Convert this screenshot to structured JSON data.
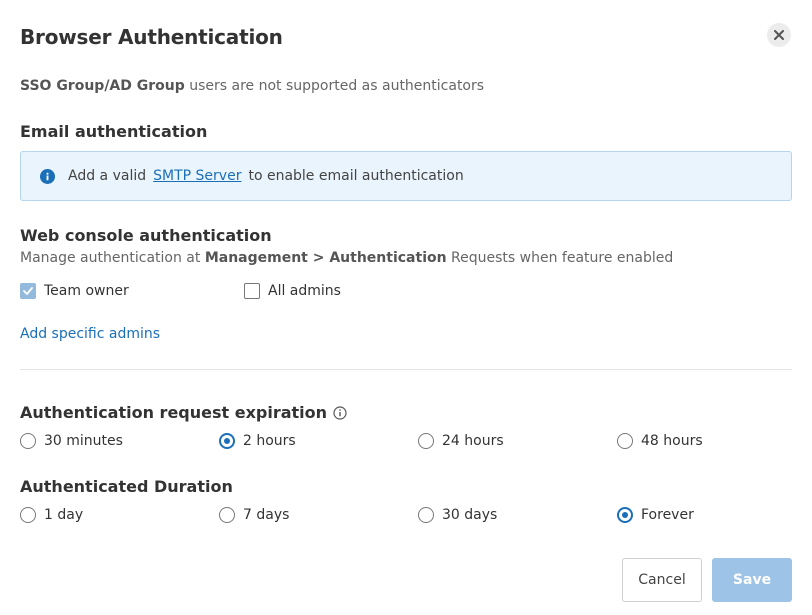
{
  "dialog": {
    "title": "Browser Authentication",
    "note_bold": "SSO Group/AD Group",
    "note_rest": " users are not supported as authenticators"
  },
  "email_section": {
    "title": "Email authentication",
    "info_before": "Add a valid",
    "info_link": "SMTP Server",
    "info_after": "to enable email authentication"
  },
  "web_console": {
    "title": "Web console authentication",
    "desc_prefix": "Manage authentication at ",
    "desc_bold": "Management > Authentication",
    "desc_suffix": " Requests when feature enabled",
    "checkboxes": [
      {
        "label": "Team owner",
        "checked": true
      },
      {
        "label": "All admins",
        "checked": false
      }
    ],
    "add_link": "Add specific admins"
  },
  "expiration": {
    "title": "Authentication request expiration",
    "options": [
      "30 minutes",
      "2 hours",
      "24 hours",
      "48 hours"
    ],
    "selected": "2 hours"
  },
  "duration": {
    "title": "Authenticated Duration",
    "options": [
      "1 day",
      "7 days",
      "30 days",
      "Forever"
    ],
    "selected": "Forever"
  },
  "footer": {
    "cancel_label": "Cancel",
    "save_label": "Save"
  },
  "colors": {
    "accent": "#1a6fb8",
    "info_bg": "#eaf4fc",
    "save_disabled": "#9dc3e6"
  }
}
